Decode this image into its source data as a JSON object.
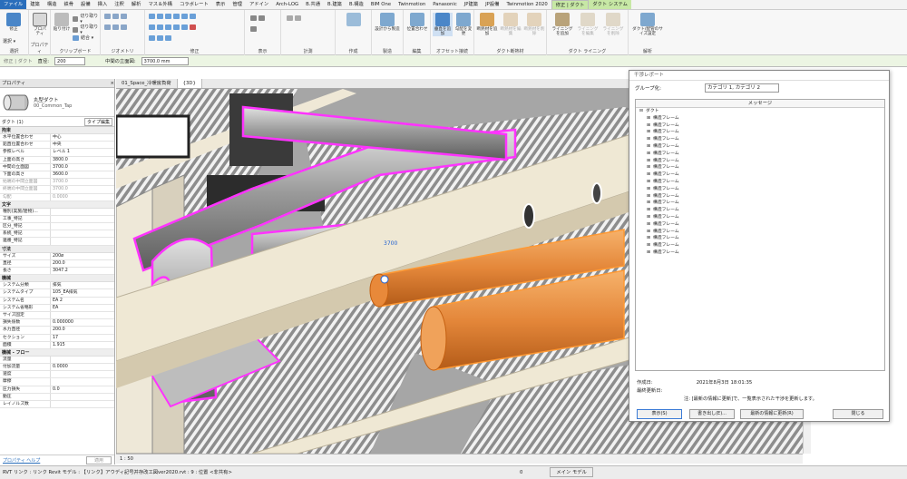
{
  "menubar": {
    "tabs": [
      "ファイル",
      "建築",
      "構造",
      "鉄骨",
      "設備",
      "挿入",
      "注釈",
      "解析",
      "マス＆外構",
      "コラボレート",
      "表示",
      "管理",
      "アドイン",
      "Arch-LOG",
      "B.共通",
      "B.建築",
      "B.構造",
      "BIM One",
      "Twinmotion",
      "Panasonic",
      "JP建築",
      "JP設備",
      "Twinmotion 2020",
      "修正 | ダクト",
      "ダクト システム"
    ]
  },
  "ribbon": {
    "groups": [
      "選択",
      "プロパティ",
      "クリップボード",
      "ジオメトリ",
      "修正",
      "表示",
      "計測",
      "作成",
      "製造",
      "編集",
      "オフセット接続",
      "ダクト断熱材",
      "ダクト ライニング",
      "解析"
    ],
    "select_btn": "修正",
    "select_drop": "選択 ▾",
    "prop_btn": "プロパティ",
    "paste_label": "貼り付け",
    "cut_label": "切り取り ▾",
    "copy_label": "切り取り ▾",
    "join_label": "結合 ▾",
    "design_label": "設計から製造",
    "position_label": "位置合わせ",
    "justify_label": "垂直を追加",
    "offset_label": "勾配を変更",
    "ins_add": "断熱材を追加",
    "ins_edit": "断熱材を編集",
    "ins_remove": "断熱材を削除",
    "lin_add": "ライニングを追加",
    "lin_edit": "ライニングを編集",
    "lin_remove": "ライニングを削除",
    "sizing_label": "ダクト/配管のサイズ設定"
  },
  "optionsbar": {
    "context": "修正 | ダクト",
    "diameter_label": "直径:",
    "diameter_value": "200",
    "center_label": "中間の立面図:",
    "center_value": "3700.0 mm"
  },
  "properties": {
    "header": "プロパティ",
    "type_name": "丸型ダクト",
    "type_sub": "00_Common_Tap",
    "instance": "ダクト (1)",
    "edit_type": "タイプ編集",
    "sections": [
      {
        "title": "拘束",
        "rows": [
          [
            "水平位置合わせ",
            "中心"
          ],
          [
            "鉛直位置合わせ",
            "中央"
          ],
          [
            "参照レベル",
            "レベル 1"
          ],
          [
            "上面の高さ",
            "3800.0"
          ],
          [
            "中間の立面図",
            "3700.0"
          ],
          [
            "下面の高さ",
            "3600.0"
          ],
          [
            "始端の中間立面図",
            "3700.0"
          ],
          [
            "終端の中間立面図",
            "3700.0"
          ],
          [
            "勾配",
            "0.0000"
          ]
        ]
      },
      {
        "title": "文字",
        "rows": [
          [
            "種別(実施/建物)...",
            ""
          ],
          [
            "工事_特記",
            ""
          ],
          [
            "区分_特記",
            ""
          ],
          [
            "系統_特記",
            ""
          ],
          [
            "連番_特記",
            ""
          ]
        ]
      },
      {
        "title": "寸法",
        "rows": [
          [
            "サイズ",
            "200ø"
          ],
          [
            "直径",
            "200.0"
          ],
          [
            "長さ",
            "3047.2"
          ]
        ]
      },
      {
        "title": "機械",
        "rows": [
          [
            "システム分類",
            "排気"
          ],
          [
            "システムタイプ",
            "105_EA排気"
          ],
          [
            "システム名",
            "EA 2"
          ],
          [
            "システム省略形",
            "EA"
          ],
          [
            "サイズ固定",
            ""
          ],
          [
            "損失係数",
            "0.000000"
          ],
          [
            "水力直径",
            "200.0"
          ],
          [
            "セクション",
            "17"
          ],
          [
            "面積",
            "1.915"
          ]
        ]
      },
      {
        "title": "機械 - フロー",
        "rows": [
          [
            "流量",
            ""
          ],
          [
            "付加流量",
            "0.0000"
          ],
          [
            "速度",
            ""
          ],
          [
            "摩擦",
            ""
          ],
          [
            "圧力損失",
            "0.0"
          ],
          [
            "動圧",
            ""
          ],
          [
            "レイノルズ数",
            ""
          ]
        ]
      }
    ],
    "help_link": "プロパティ ヘルプ",
    "apply": "適用"
  },
  "viewtabs": [
    "01_Space_冷暖房負荷",
    "{3D}"
  ],
  "viewbar": {
    "scale": "1 : 50"
  },
  "status": {
    "text": "RVT リンク : リンク Revit モデル : 【リンク】アウディ記号并存改工図ver2020.rvt : 9 : 位置 <非共有>",
    "model": "メイン モデル",
    "zero": "0"
  },
  "dialog": {
    "title": "干渉レポート",
    "group_label": "グループ化:",
    "group_value": "カテゴリ 1, カテゴリ 2",
    "message_header": "メッセージ",
    "tree_root": "ダクト",
    "items": [
      "構造フレーム",
      "構造フレーム",
      "構造フレーム",
      "構造フレーム",
      "構造フレーム",
      "構造フレーム",
      "構造フレーム",
      "構造フレーム",
      "構造フレーム",
      "構造フレーム",
      "構造フレーム",
      "構造フレーム",
      "構造フレーム",
      "構造フレーム",
      "構造フレーム",
      "構造フレーム",
      "構造フレーム",
      "構造フレーム",
      "構造フレーム",
      "構造フレーム"
    ],
    "created_label": "作成日:",
    "created_value": "2021年8月3日 18:01:35",
    "updated_label": "最終更新日:",
    "note": "注: [最新の情報に更新]で、一覧表示された干渉を更新します。",
    "buttons": [
      "表示(S)",
      "書き出し(E)...",
      "最新の情報に更新(R)",
      "閉じる"
    ]
  },
  "view_label": "3700"
}
